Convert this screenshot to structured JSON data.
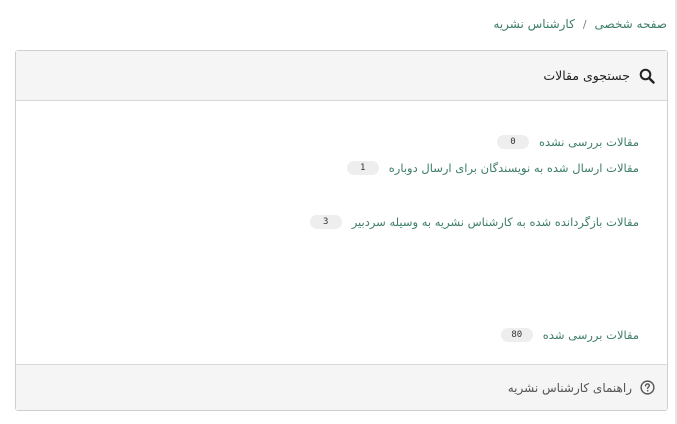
{
  "breadcrumb": {
    "items": [
      "صفحه شخصی",
      "کارشناس نشریه"
    ],
    "separator": "/"
  },
  "panel": {
    "title": "جستجوی مقالات",
    "rows": [
      {
        "label": "مقالات بررسی نشده",
        "count": "0"
      },
      {
        "label": "مقالات ارسال شده به نویسندگان برای ارسال دوباره",
        "count": "1"
      },
      {
        "label": "مقالات بازگردانده شده به کارشناس نشریه به وسیله سردبیر",
        "count": "3"
      },
      {
        "label": "مقالات بررسی شده",
        "count": "80"
      }
    ],
    "footer_link": "راهنمای کارشناس نشریه"
  },
  "icons": {
    "search": "search-icon",
    "help": "question-circle-icon"
  },
  "colors": {
    "link": "#3d7d6b",
    "panel_bg": "#f5f5f5",
    "badge_bg": "#eeeeee"
  }
}
